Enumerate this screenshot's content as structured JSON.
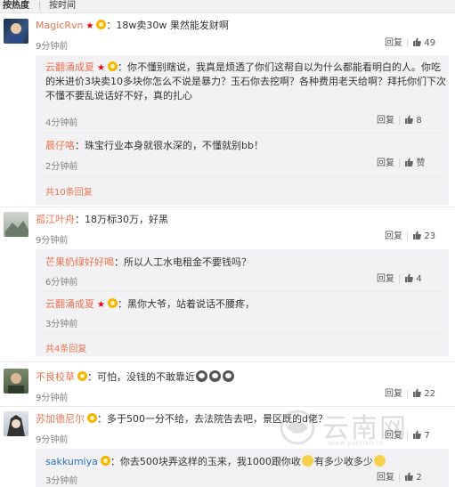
{
  "sort_tabs": {
    "hot": "按热度",
    "separator": "|",
    "time": "按时间"
  },
  "actions": {
    "reply": "回复",
    "separator": "|"
  },
  "watermark": {
    "text": "云南网",
    "url": "www.yunnan.cn"
  },
  "colors": {
    "username": "#eb7350",
    "link": "#eb7350",
    "time": "#808080",
    "sub_bg": "#f2f2f5"
  },
  "comments": [
    {
      "user": "MagicRvn",
      "text": "：18w卖30w 果然能发财啊",
      "time": "9分钟前",
      "likes": "49",
      "replies": [
        {
          "user": "云翻涌成夏",
          "text_lines": [
            "：你不懂别瞎说，我真是烦透了你们这帮自以为什么都能看明白的人。你吃",
            "的米进价3块卖10多块你怎么不说是暴力？玉石你去挖啊？各种费用老天给啊？拜托你们下次",
            "不懂不要乱说话好不好，真的扎心"
          ],
          "time": "4分钟前",
          "likes": "8"
        },
        {
          "user": "晨仔咯",
          "text": "：珠宝行业本身就很水深的，不懂就别bb！",
          "time": "2分钟前",
          "likes": "赞"
        }
      ],
      "more": "共10条回复"
    },
    {
      "user": "孤江叶舟",
      "text": "：18万标30万，好黑",
      "time": "9分钟前",
      "likes": "23",
      "replies": [
        {
          "user": "芒果奶绿好好喝",
          "text": "：所以人工水电租金不要钱吗？",
          "time": "6分钟前",
          "likes": "4"
        },
        {
          "user": "云翻涌成夏",
          "text": "：黑你大爷，站着说话不腰疼，",
          "time": "3分钟前",
          "likes": ""
        }
      ],
      "more": "共4条回复"
    },
    {
      "user": "不良校草",
      "text": "：可怕，没钱的不敢靠近",
      "time": "9分钟前",
      "likes": "22"
    },
    {
      "user": "苏加德尼尔",
      "text": "：多于500一分不给，去法院告去吧，景区既的d佬？",
      "time": "9分钟前",
      "likes": "7",
      "replies": [
        {
          "user": "sakkumiya",
          "text_a": "：你去500块弄这样的玉来，我1000跟你收",
          "text_b": "有多少收多少",
          "time": "3分钟前",
          "likes": "2"
        }
      ]
    }
  ]
}
